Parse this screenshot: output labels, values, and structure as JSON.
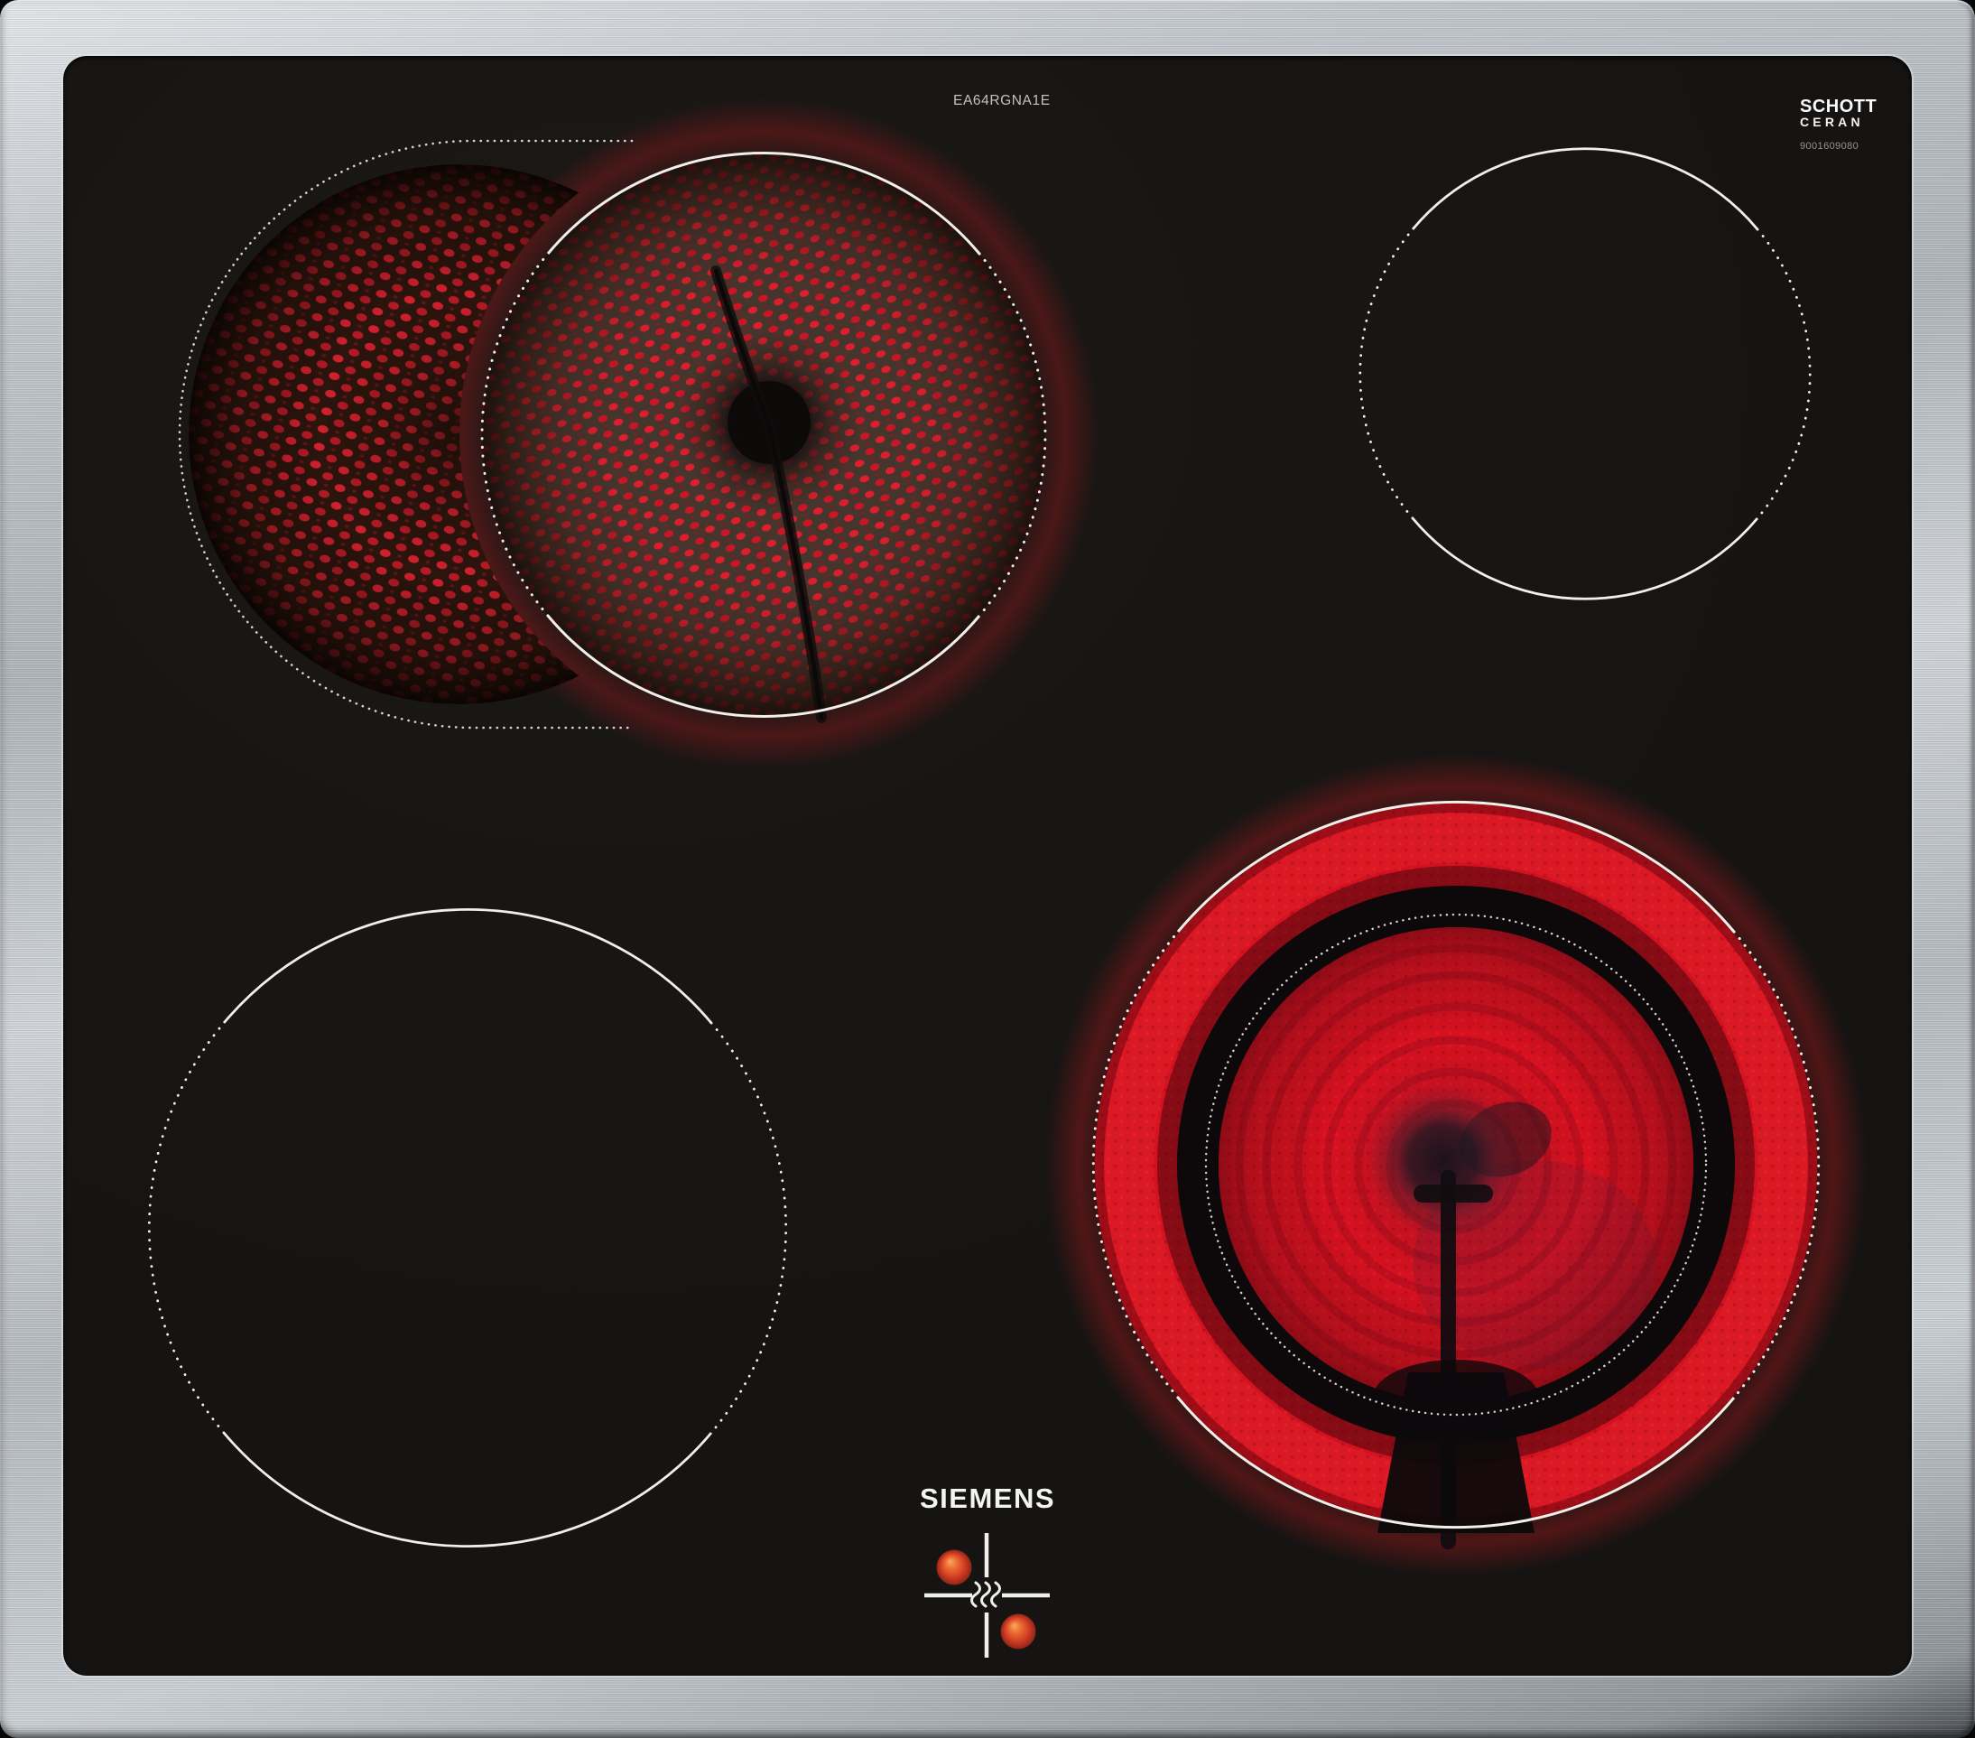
{
  "product": {
    "brand": "SIEMENS",
    "model": "EA64RGNA1E"
  },
  "glass_branding": {
    "maker": "SCHOTT",
    "series": "CERAN",
    "part_number": "9001609080"
  },
  "zones": [
    {
      "position": "rear-left",
      "type": "dual-circuit radiant zone",
      "state": "on",
      "appearance": "outer crescent segment and main coil glowing bright red"
    },
    {
      "position": "rear-right",
      "type": "single-circuit radiant zone",
      "state": "off"
    },
    {
      "position": "front-left",
      "type": "single-circuit radiant zone",
      "state": "off"
    },
    {
      "position": "front-right",
      "type": "dual-circuit radiant zone",
      "state": "on",
      "appearance": "outer ring and inner disc glowing bright red"
    }
  ],
  "residual_heat_indicator": {
    "symbol": "heat-waves cross",
    "hot_zone_dots": 2
  },
  "colors": {
    "frame": "#c7ccd1",
    "glass": "#161412",
    "glow_bright": "#e01b2b",
    "glow_deep": "#8c0f18",
    "zone_outline": "#f1efe9",
    "hot_dot": "#e0552b"
  }
}
